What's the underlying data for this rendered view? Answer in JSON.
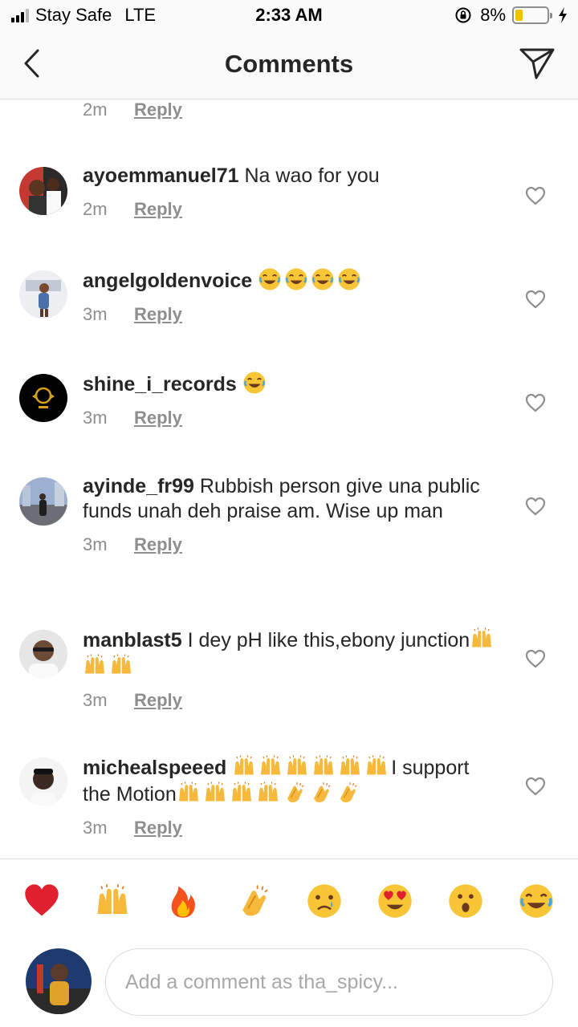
{
  "status_bar": {
    "carrier": "Stay Safe",
    "network": "LTE",
    "time": "2:33 AM",
    "battery": "8%",
    "battery_level": 0.08,
    "signal_bars": 3,
    "icons": [
      "signal-icon",
      "orientation-lock-icon",
      "battery-icon",
      "charging-bolt-icon"
    ]
  },
  "header": {
    "title": "Comments",
    "back_icon": "chevron-left-icon",
    "send_icon": "paper-plane-icon"
  },
  "partial_comment": {
    "time": "2m",
    "reply": "Reply"
  },
  "comments": [
    {
      "username": "ayoemmanuel71",
      "text": "Na wao for you",
      "emoji": [],
      "time": "2m",
      "reply": "Reply",
      "avatar_color": "#b0322e"
    },
    {
      "username": "angelgoldenvoice",
      "text": "",
      "emoji": [
        "laughing-face",
        "laughing-face",
        "laughing-face",
        "laughing-face"
      ],
      "time": "3m",
      "reply": "Reply",
      "avatar_color": "#c9ced6"
    },
    {
      "username": "shine_i_records",
      "text": "",
      "emoji": [
        "laughing-face"
      ],
      "time": "3m",
      "reply": "Reply",
      "avatar_color": "#000000"
    },
    {
      "username": "ayinde_fr99",
      "text": "Rubbish person give una public funds unah deh praise am. Wise up man",
      "emoji": [],
      "time": "3m",
      "reply": "Reply",
      "avatar_color": "#7d8fae"
    },
    {
      "username": "manblast5",
      "text": "I dey pH like this,ebony junction",
      "emoji": [
        "raising-hands",
        "raising-hands",
        "raising-hands"
      ],
      "time": "3m",
      "reply": "Reply",
      "avatar_color": "#9a9a9a"
    },
    {
      "username": "michealspeeed",
      "text_before": "",
      "emoji_before": [
        "raising-hands",
        "raising-hands",
        "raising-hands",
        "raising-hands",
        "raising-hands",
        "raising-hands"
      ],
      "text": "I support the Motion",
      "emoji": [
        "raising-hands",
        "raising-hands",
        "raising-hands",
        "raising-hands",
        "clapping-hands",
        "clapping-hands",
        "clapping-hands"
      ],
      "time": "3m",
      "reply": "Reply",
      "avatar_color": "#e8e8e8"
    }
  ],
  "heart_icon": "heart-outline-icon",
  "emoji_bar": [
    "red-heart",
    "raising-hands",
    "fire",
    "clapping-hands",
    "crying-face",
    "heart-eyes-face",
    "surprised-face",
    "laughing-face"
  ],
  "composer": {
    "placeholder": "Add a comment as tha_spicy...",
    "value": ""
  },
  "colors": {
    "text_primary": "#262626",
    "text_secondary": "#8e8e8e",
    "divider": "#dbdbdb",
    "bar_background": "#fafafa",
    "battery_yellow": "#f0c200"
  }
}
